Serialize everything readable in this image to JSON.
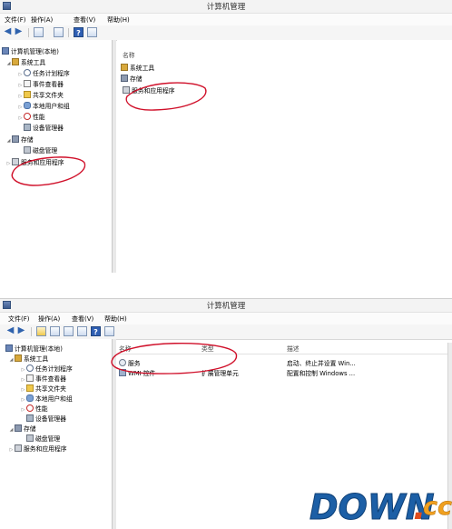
{
  "window1": {
    "title": "计算机管理",
    "menu": [
      "文件(F)",
      "操作(A)",
      "查看(V)",
      "帮助(H)"
    ],
    "tree": [
      {
        "label": "计算机管理(本地)",
        "icon": "computer-icon",
        "level": 0
      },
      {
        "label": "系统工具",
        "icon": "tools-icon",
        "level": 1,
        "expanded": true
      },
      {
        "label": "任务计划程序",
        "icon": "clock-icon",
        "level": 2
      },
      {
        "label": "事件查看器",
        "icon": "event-log-icon",
        "level": 2
      },
      {
        "label": "共享文件夹",
        "icon": "folder-icon",
        "level": 2
      },
      {
        "label": "本地用户和组",
        "icon": "users-icon",
        "level": 2
      },
      {
        "label": "性能",
        "icon": "performance-icon",
        "level": 2
      },
      {
        "label": "设备管理器",
        "icon": "device-icon",
        "level": 2
      },
      {
        "label": "存储",
        "icon": "storage-icon",
        "level": 1,
        "expanded": true
      },
      {
        "label": "磁盘管理",
        "icon": "disk-icon",
        "level": 2
      },
      {
        "label": "服务和应用程序",
        "icon": "services-icon",
        "level": 1,
        "expanded": false
      }
    ],
    "list_header": "名称",
    "list": [
      {
        "label": "系统工具",
        "icon": "tools-icon"
      },
      {
        "label": "存储",
        "icon": "storage-icon"
      },
      {
        "label": "服务和应用程序",
        "icon": "services-icon"
      }
    ]
  },
  "window2": {
    "title": "计算机管理",
    "menu": [
      "文件(F)",
      "操作(A)",
      "查看(V)",
      "帮助(H)"
    ],
    "tree": [
      {
        "label": "计算机管理(本地)",
        "icon": "computer-icon",
        "level": 0
      },
      {
        "label": "系统工具",
        "icon": "tools-icon",
        "level": 1,
        "expanded": true
      },
      {
        "label": "任务计划程序",
        "icon": "clock-icon",
        "level": 2
      },
      {
        "label": "事件查看器",
        "icon": "event-log-icon",
        "level": 2
      },
      {
        "label": "共享文件夹",
        "icon": "folder-icon",
        "level": 2
      },
      {
        "label": "本地用户和组",
        "icon": "users-icon",
        "level": 2
      },
      {
        "label": "性能",
        "icon": "performance-icon",
        "level": 2
      },
      {
        "label": "设备管理器",
        "icon": "device-icon",
        "level": 2
      },
      {
        "label": "存储",
        "icon": "storage-icon",
        "level": 1,
        "expanded": true
      },
      {
        "label": "磁盘管理",
        "icon": "disk-icon",
        "level": 2
      },
      {
        "label": "服务和应用程序",
        "icon": "services-icon",
        "level": 1,
        "expanded": false
      }
    ],
    "columns": [
      "名称",
      "类型",
      "描述"
    ],
    "rows": [
      {
        "name": "服务",
        "type": "",
        "desc": "启动、终止并设置 Win...",
        "icon": "gear-icon"
      },
      {
        "name": "WMI 控件",
        "type": "扩展管理单元",
        "desc": "配置和控制 Windows ...",
        "icon": "wmi-icon"
      }
    ]
  },
  "watermark": {
    "main": "DOWN",
    "dot": ".",
    "suffix": "cc"
  },
  "colors": {
    "annotation": "#d0102a",
    "accent": "#2f62ad"
  }
}
